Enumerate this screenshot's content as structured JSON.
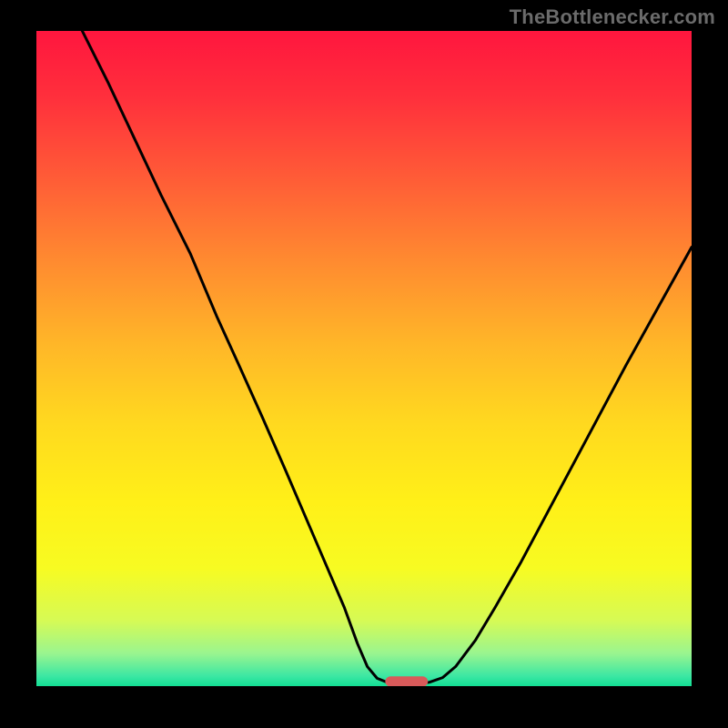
{
  "watermark": "TheBottlenecker.com",
  "chart_data": {
    "type": "line",
    "title": "",
    "xlabel": "",
    "ylabel": "",
    "xlim": [
      0,
      100
    ],
    "ylim": [
      0,
      100
    ],
    "gradient_stops": [
      {
        "offset": 0.0,
        "color": "#ff163e"
      },
      {
        "offset": 0.1,
        "color": "#ff2f3c"
      },
      {
        "offset": 0.22,
        "color": "#ff5a37"
      },
      {
        "offset": 0.35,
        "color": "#ff8a30"
      },
      {
        "offset": 0.48,
        "color": "#ffb728"
      },
      {
        "offset": 0.6,
        "color": "#ffd91f"
      },
      {
        "offset": 0.72,
        "color": "#fff018"
      },
      {
        "offset": 0.82,
        "color": "#f7fb22"
      },
      {
        "offset": 0.9,
        "color": "#d6fa55"
      },
      {
        "offset": 0.95,
        "color": "#9af58f"
      },
      {
        "offset": 0.985,
        "color": "#3be7a3"
      },
      {
        "offset": 1.0,
        "color": "#13df94"
      }
    ],
    "series": [
      {
        "name": "bottleneck-curve",
        "stroke": "#000000",
        "points": [
          {
            "x": 7.0,
            "y": 100.0
          },
          {
            "x": 11.0,
            "y": 92.0
          },
          {
            "x": 15.0,
            "y": 83.5
          },
          {
            "x": 19.0,
            "y": 75.0
          },
          {
            "x": 23.5,
            "y": 66.0
          },
          {
            "x": 27.5,
            "y": 56.5
          },
          {
            "x": 31.0,
            "y": 48.8
          },
          {
            "x": 34.5,
            "y": 41.0
          },
          {
            "x": 38.0,
            "y": 33.0
          },
          {
            "x": 41.0,
            "y": 26.0
          },
          {
            "x": 44.0,
            "y": 19.0
          },
          {
            "x": 47.0,
            "y": 12.0
          },
          {
            "x": 49.0,
            "y": 6.5
          },
          {
            "x": 50.5,
            "y": 3.0
          },
          {
            "x": 52.0,
            "y": 1.2
          },
          {
            "x": 54.0,
            "y": 0.4
          },
          {
            "x": 56.0,
            "y": 0.2
          },
          {
            "x": 58.0,
            "y": 0.3
          },
          {
            "x": 60.0,
            "y": 0.6
          },
          {
            "x": 62.0,
            "y": 1.3
          },
          {
            "x": 64.0,
            "y": 3.0
          },
          {
            "x": 67.0,
            "y": 7.0
          },
          {
            "x": 70.0,
            "y": 12.0
          },
          {
            "x": 74.0,
            "y": 19.0
          },
          {
            "x": 78.0,
            "y": 26.5
          },
          {
            "x": 82.0,
            "y": 34.0
          },
          {
            "x": 86.0,
            "y": 41.5
          },
          {
            "x": 90.0,
            "y": 49.0
          },
          {
            "x": 95.0,
            "y": 58.0
          },
          {
            "x": 100.0,
            "y": 67.0
          }
        ]
      }
    ],
    "marker": {
      "x": 56.5,
      "y": 0.7,
      "width": 6.5,
      "height": 1.6,
      "color": "#d85a5a",
      "name": "target-marker"
    }
  }
}
